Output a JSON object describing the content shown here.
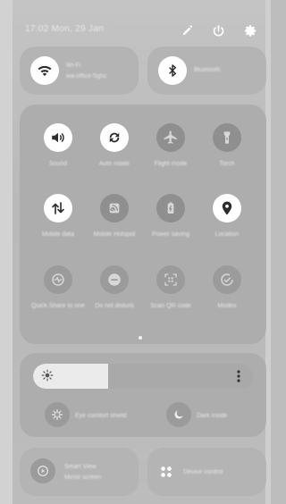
{
  "status": {
    "datetime": "17:02  Mon, 29 Jan"
  },
  "header_icons": [
    {
      "icon": "pencil-icon",
      "name": "edit-button"
    },
    {
      "icon": "power-icon",
      "name": "power-button"
    },
    {
      "icon": "gear-icon",
      "name": "settings-button"
    }
  ],
  "wifi": {
    "title": "Wi-Fi",
    "subtitle": "wa-office-5ghz",
    "icon": "wifi-icon",
    "state": "on"
  },
  "bluetooth": {
    "title": "Bluetooth",
    "icon": "bluetooth-icon",
    "state": "on"
  },
  "toggles": [
    {
      "key": "sound",
      "label": "Sound",
      "icon": "volume-icon",
      "state": "on"
    },
    {
      "key": "autorotate",
      "label": "Auto rotate",
      "icon": "rotate-icon",
      "state": "on"
    },
    {
      "key": "flight",
      "label": "Flight mode",
      "icon": "airplane-icon",
      "state": "off"
    },
    {
      "key": "torch",
      "label": "Torch",
      "icon": "flashlight-icon",
      "state": "off"
    },
    {
      "key": "mobiledata",
      "label": "Mobile data",
      "icon": "data-arrows-icon",
      "state": "on"
    },
    {
      "key": "hotspot",
      "label": "Mobile Hotspot",
      "icon": "hotspot-icon",
      "state": "off"
    },
    {
      "key": "powersaving",
      "label": "Power saving",
      "icon": "battery-icon",
      "state": "off"
    },
    {
      "key": "location",
      "label": "Location",
      "icon": "location-pin-icon",
      "state": "on"
    },
    {
      "key": "quickshare",
      "label": "Quick Share to one",
      "icon": "quickshare-icon",
      "state": "off"
    },
    {
      "key": "dnd",
      "label": "Do not disturb",
      "icon": "minus-circle-icon",
      "state": "off"
    },
    {
      "key": "qr",
      "label": "Scan QR code",
      "icon": "qr-scan-icon",
      "state": "off"
    },
    {
      "key": "modes",
      "label": "Modes",
      "icon": "check-circle-icon",
      "state": "off"
    }
  ],
  "brightness": {
    "level": 0.34,
    "icon": "sun-icon",
    "more_icon": "more-vertical-icon"
  },
  "eye_comfort": {
    "label": "Eye comfort shield",
    "icon": "eye-comfort-icon"
  },
  "dark_mode": {
    "label": "Dark mode",
    "icon": "moon-icon"
  },
  "smart_view": {
    "title": "Smart View",
    "subtitle": "Mirror screen",
    "icon": "smart-view-icon"
  },
  "device_control": {
    "title": "Device control",
    "icon": "grid-icon"
  }
}
